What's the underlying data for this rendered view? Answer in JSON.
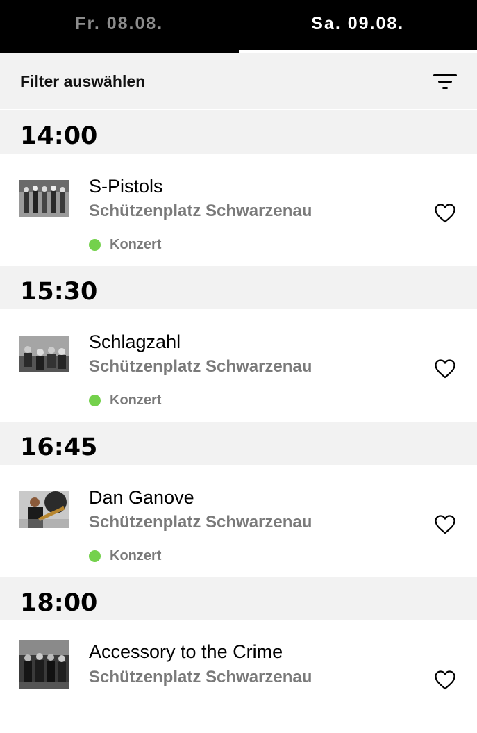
{
  "tabs": [
    {
      "label": "Fr. 08.08.",
      "active": false
    },
    {
      "label": "Sa. 09.08.",
      "active": true
    }
  ],
  "filter": {
    "label": "Filter auswählen",
    "icon": "filter-icon"
  },
  "accent_color": "#74d14c",
  "events": [
    {
      "time": "14:00",
      "title": "S-Pistols",
      "venue": "Schützenplatz Schwarzenau",
      "category": "Konzert",
      "favorite": false
    },
    {
      "time": "15:30",
      "title": "Schlagzahl",
      "venue": "Schützenplatz Schwarzenau",
      "category": "Konzert",
      "favorite": false
    },
    {
      "time": "16:45",
      "title": "Dan Ganove",
      "venue": "Schützenplatz Schwarzenau",
      "category": "Konzert",
      "favorite": false
    },
    {
      "time": "18:00",
      "title": "Accessory to the Crime",
      "venue": "Schützenplatz Schwarzenau",
      "category": "",
      "favorite": false
    }
  ]
}
